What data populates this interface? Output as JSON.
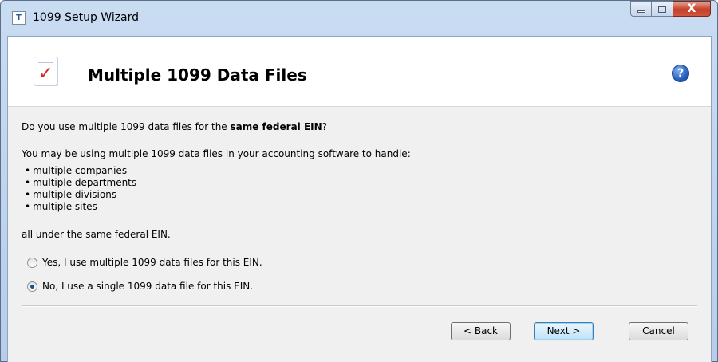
{
  "window": {
    "title": "1099 Setup Wizard",
    "app_icon_text": "T",
    "close_glyph": "X"
  },
  "header": {
    "title": "Multiple 1099 Data Files",
    "help_glyph": "?"
  },
  "content": {
    "question_prefix": "Do you use multiple 1099 data files for the ",
    "question_bold": "same federal EIN",
    "question_suffix": "?",
    "intro": "You may be using multiple 1099 data files in your accounting software to handle:",
    "bullets": [
      "multiple companies",
      "multiple departments",
      "multiple divisions",
      "multiple sites"
    ],
    "outro": "all under the same federal EIN."
  },
  "options": {
    "yes_label": "Yes, I use multiple 1099 data files for this EIN.",
    "no_label": "No, I use a single 1099 data file for this EIN.",
    "selected": "no"
  },
  "buttons": {
    "back": "< Back",
    "next": "Next >",
    "cancel": "Cancel"
  },
  "colors": {
    "window_frame": "#c9dcf2",
    "dialog_bg": "#f0f0f0",
    "accent_check": "#d42a1e",
    "help_blue": "#1d55b8"
  }
}
